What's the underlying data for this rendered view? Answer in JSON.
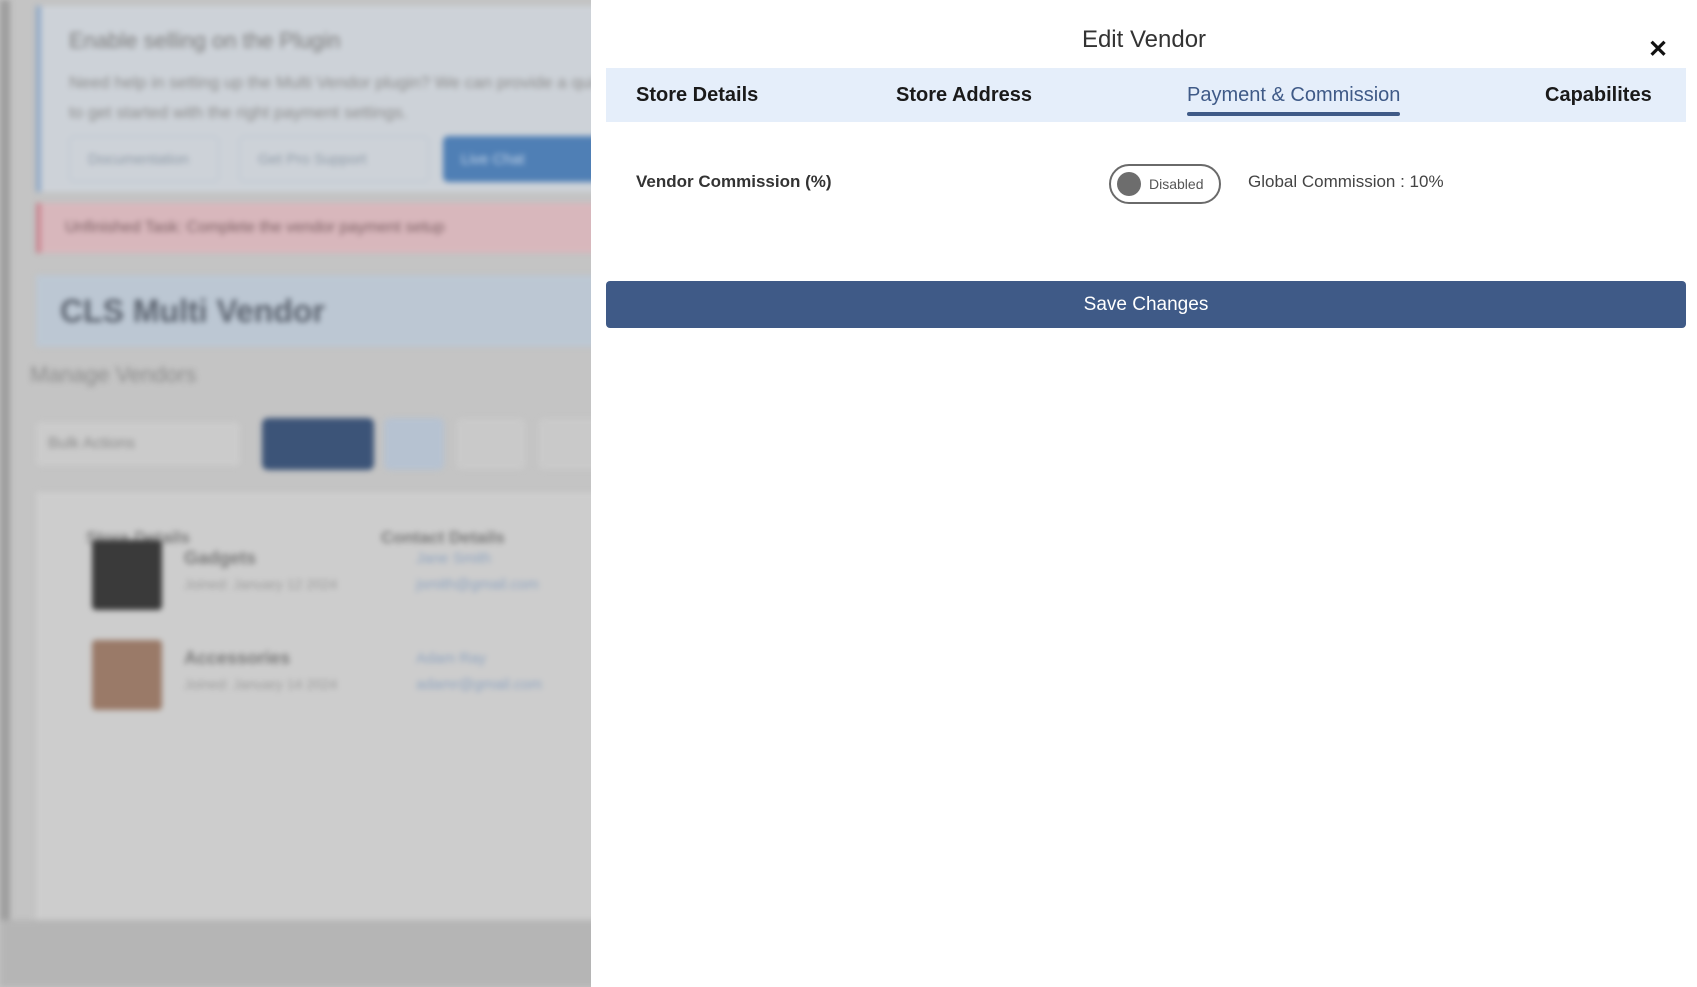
{
  "background": {
    "notice_title": "Enable selling on the Plugin",
    "notice_text": "Need help in setting up the Multi Vendor plugin? We can provide a quick setup to get started with the right payment settings.",
    "notice_buttons": [
      "Documentation",
      "Get Pro Support",
      "Live Chat"
    ],
    "error_text": "Unfinished Task: Complete the vendor payment setup",
    "header_title": "CLS Multi Vendor",
    "subtitle": "Manage Vendors",
    "bulk_select": "Bulk Actions",
    "table_headers": [
      "Store Details",
      "Contact Details"
    ],
    "rows": [
      {
        "name": "Gadgets",
        "sub": "Joined: January 12 2024",
        "contact_name": "Jane Smith",
        "contact_email": "jsmith@gmail.com"
      },
      {
        "name": "Accessories",
        "sub": "Joined: January 14 2024",
        "contact_name": "Adam Ray",
        "contact_email": "adamr@gmail.com"
      }
    ]
  },
  "drawer": {
    "title": "Edit Vendor",
    "close_icon": "close-icon",
    "tabs": [
      {
        "label": "Store Details",
        "active": false
      },
      {
        "label": "Store Address",
        "active": false
      },
      {
        "label": "Payment & Commission",
        "active": true
      },
      {
        "label": "Capabilites",
        "active": false
      }
    ],
    "commission_label": "Vendor Commission (%)",
    "toggle_state": "Disabled",
    "global_commission": "Global Commission : 10%",
    "save_label": "Save Changes"
  },
  "colors": {
    "accent": "#3f5a87",
    "tab_bar": "#e5eefa",
    "overlay": "#c4c4c4"
  }
}
